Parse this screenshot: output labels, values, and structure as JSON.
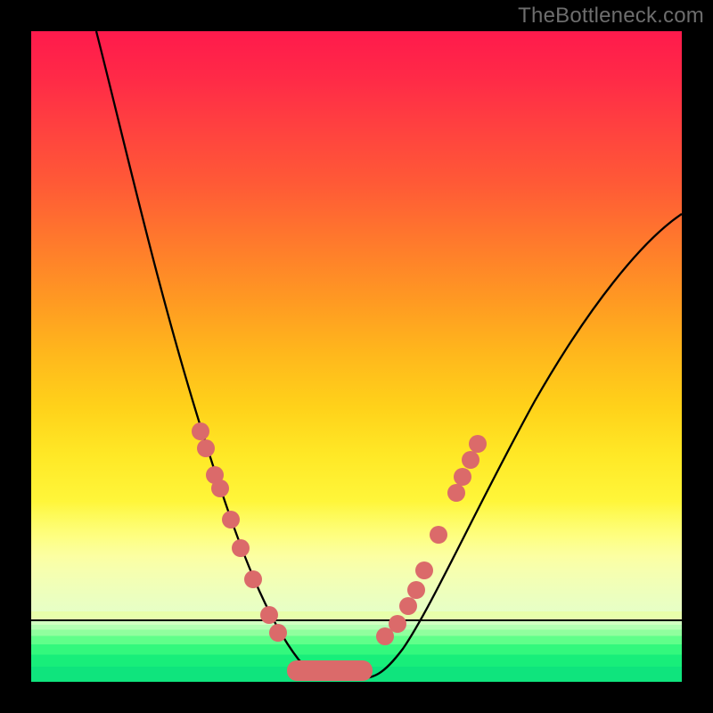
{
  "watermark": "TheBottleneck.com",
  "chart_data": {
    "type": "line",
    "title": "",
    "xlabel": "",
    "ylabel": "",
    "xlim": [
      0,
      100
    ],
    "ylim": [
      0,
      100
    ],
    "grid": false,
    "legend": false,
    "curve_approx_points": [
      {
        "x": 10,
        "y": 100
      },
      {
        "x": 14,
        "y": 88
      },
      {
        "x": 18,
        "y": 72
      },
      {
        "x": 22,
        "y": 55
      },
      {
        "x": 26,
        "y": 40
      },
      {
        "x": 30,
        "y": 28
      },
      {
        "x": 34,
        "y": 17
      },
      {
        "x": 38,
        "y": 8
      },
      {
        "x": 42,
        "y": 2
      },
      {
        "x": 46,
        "y": 0
      },
      {
        "x": 50,
        "y": 0
      },
      {
        "x": 54,
        "y": 5
      },
      {
        "x": 58,
        "y": 14
      },
      {
        "x": 64,
        "y": 28
      },
      {
        "x": 72,
        "y": 44
      },
      {
        "x": 82,
        "y": 58
      },
      {
        "x": 92,
        "y": 67
      },
      {
        "x": 100,
        "y": 72
      }
    ],
    "note": "y is bottleneck-like penalty (0 = optimal, 100 = worst). Values estimated from pixel positions; no axes/ticks visible in source.",
    "left_markers_approx": [
      {
        "x": 26.5,
        "y": 38
      },
      {
        "x": 27.2,
        "y": 35
      },
      {
        "x": 28.5,
        "y": 31
      },
      {
        "x": 29.0,
        "y": 29
      },
      {
        "x": 30.5,
        "y": 24
      },
      {
        "x": 32.0,
        "y": 20
      },
      {
        "x": 33.5,
        "y": 15
      },
      {
        "x": 36.0,
        "y": 10
      },
      {
        "x": 37.0,
        "y": 8
      }
    ],
    "right_markers_approx": [
      {
        "x": 52.0,
        "y": 6
      },
      {
        "x": 53.5,
        "y": 8
      },
      {
        "x": 54.5,
        "y": 11
      },
      {
        "x": 55.5,
        "y": 14
      },
      {
        "x": 56.5,
        "y": 18
      },
      {
        "x": 58.5,
        "y": 24
      },
      {
        "x": 61.0,
        "y": 31
      },
      {
        "x": 62.0,
        "y": 33
      },
      {
        "x": 63.0,
        "y": 36
      },
      {
        "x": 64.0,
        "y": 38
      }
    ],
    "bottom_band_height_pct": 4,
    "bottom_band_x_range": [
      39,
      51
    ]
  },
  "colors": {
    "frame": "#000000",
    "marker": "#db6a6a",
    "curve": "#000000",
    "watermark": "#6d6d6d"
  }
}
